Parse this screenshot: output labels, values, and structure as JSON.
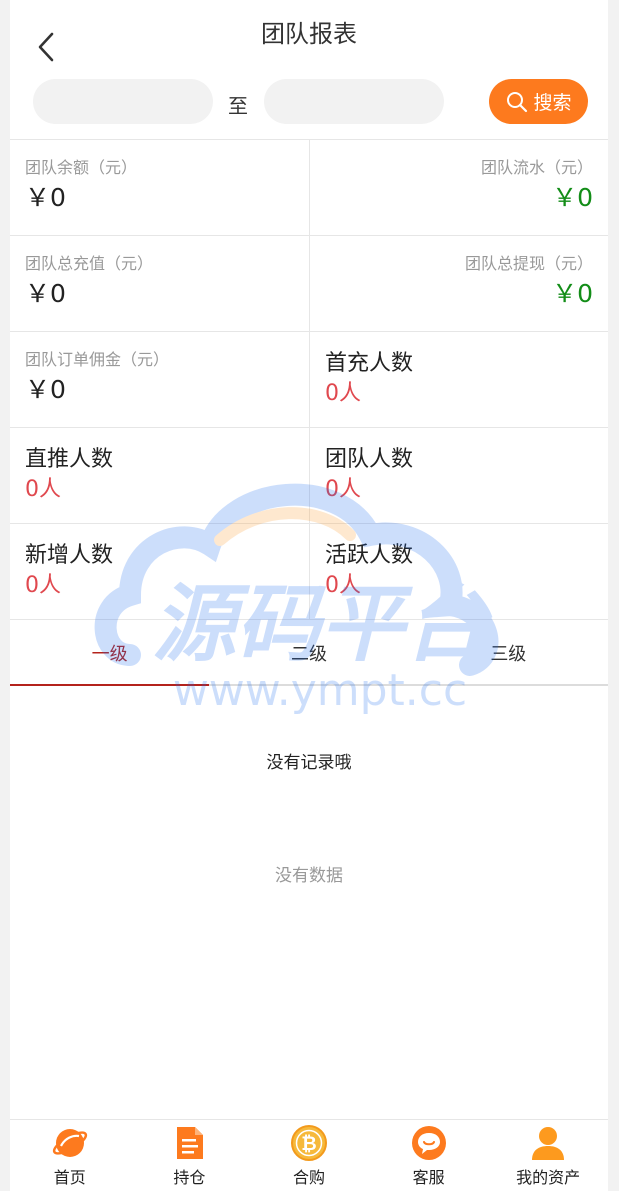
{
  "header": {
    "title": "团队报表",
    "to_label": "至",
    "search_label": "搜索"
  },
  "dates": {
    "from_value": "",
    "to_value": ""
  },
  "stats": {
    "balance": {
      "label": "团队余额（元）",
      "value": "￥0"
    },
    "flow": {
      "label": "团队流水（元）",
      "value": "￥0"
    },
    "recharge": {
      "label": "团队总充值（元）",
      "value": "￥0"
    },
    "withdraw": {
      "label": "团队总提现（元）",
      "value": "￥0"
    },
    "commission": {
      "label": "团队订单佣金（元）",
      "value": "￥0"
    },
    "first_recharge": {
      "label": "首充人数",
      "value": "0人"
    },
    "direct": {
      "label": "直推人数",
      "value": "0人"
    },
    "team": {
      "label": "团队人数",
      "value": "0人"
    },
    "new_users": {
      "label": "新增人数",
      "value": "0人"
    },
    "active": {
      "label": "活跃人数",
      "value": "0人"
    }
  },
  "tabs": [
    {
      "label": "一级",
      "active": true
    },
    {
      "label": "二级",
      "active": false
    },
    {
      "label": "三级",
      "active": false
    }
  ],
  "empty": {
    "records": "没有记录哦",
    "data": "没有数据"
  },
  "watermark": {
    "main": "源码平台",
    "url": "www.ympt.cc"
  },
  "nav": [
    {
      "label": "首页",
      "icon": "home-planet-icon"
    },
    {
      "label": "持仓",
      "icon": "document-icon"
    },
    {
      "label": "合购",
      "icon": "bitcoin-icon"
    },
    {
      "label": "客服",
      "icon": "chat-icon"
    },
    {
      "label": "我的资产",
      "icon": "user-icon"
    }
  ],
  "colors": {
    "accent": "#fd7a1e",
    "active_tab": "#b4231c",
    "green": "#138d18",
    "count_red": "#e0484e"
  }
}
